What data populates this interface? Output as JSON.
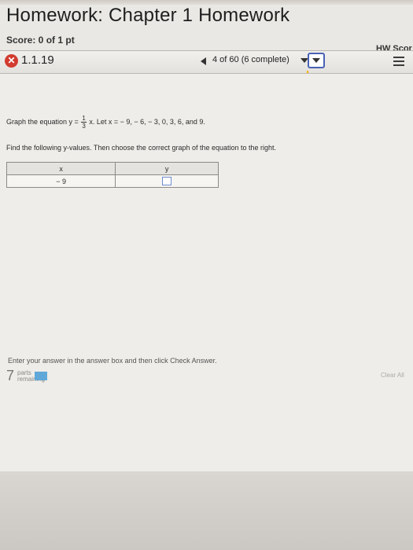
{
  "header": {
    "title": "Homework: Chapter 1 Homework",
    "score": "Score: 0 of 1 pt",
    "hw_score": "HW Scor"
  },
  "nav": {
    "question_number": "1.1.19",
    "progress": "4 of 60 (6 complete)",
    "status": "incorrect"
  },
  "question": {
    "prompt_before": "Graph the equation y =",
    "fraction_num": "1",
    "fraction_den": "3",
    "prompt_after": "x. Let x = − 9, − 6, − 3, 0, 3, 6, and 9.",
    "instruction": "Find the following y-values. Then choose the correct graph of the equation to the right.",
    "table": {
      "headers": [
        "x",
        "y"
      ],
      "rows": [
        [
          "− 9",
          ""
        ]
      ]
    }
  },
  "footer": {
    "enter_text": "Enter your answer in the answer box and then click Check Answer.",
    "parts_count": "7",
    "parts_label_1": "parts",
    "parts_label_2": "remaining",
    "clear_all": "Clear All"
  },
  "colors": {
    "accent": "#4a63b5",
    "incorrect": "#d23b2f",
    "parts_bar": "#60a8d8"
  }
}
